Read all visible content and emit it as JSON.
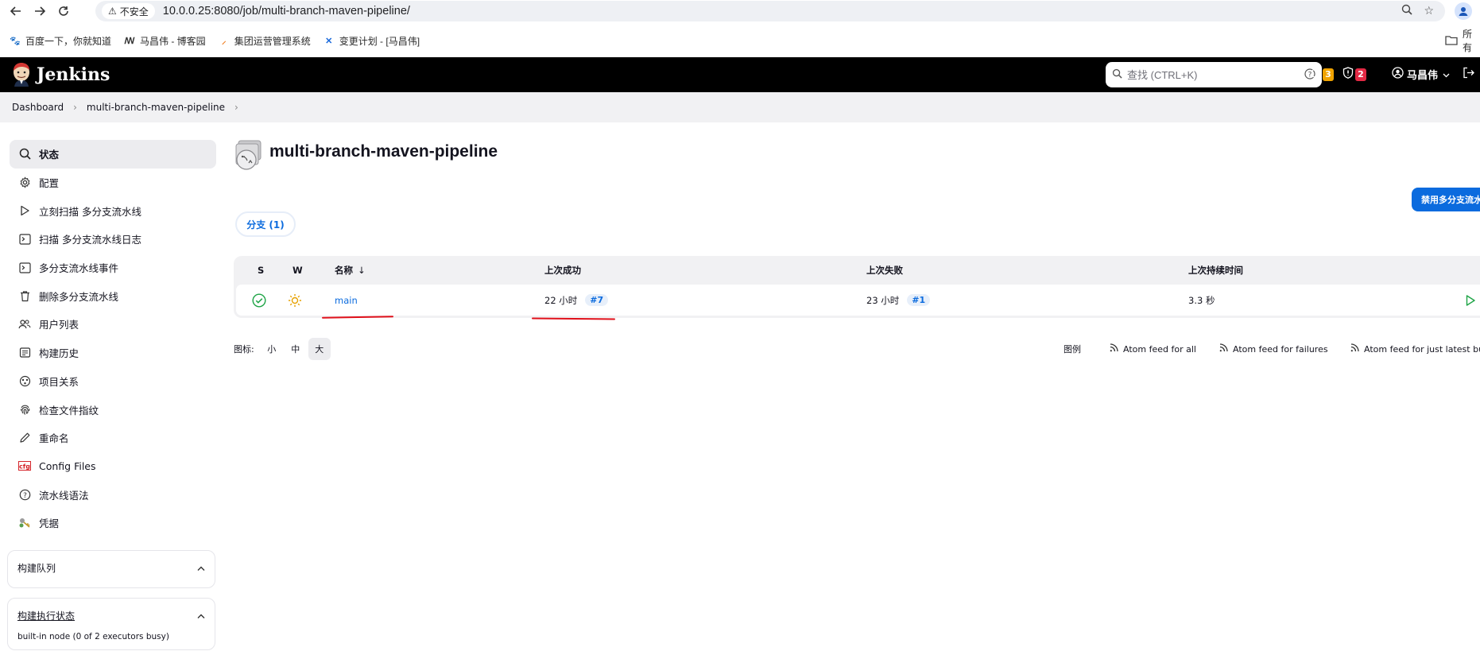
{
  "browser": {
    "insecure_label": "不安全",
    "url": "10.0.0.25:8080/job/multi-branch-maven-pipeline/",
    "bookmarks": [
      {
        "label": "百度一下，你就知道"
      },
      {
        "label": "马昌伟 - 博客园"
      },
      {
        "label": "集团运营管理系统"
      },
      {
        "label": "变更计划 - [马昌伟]"
      }
    ],
    "all_bookmarks_label": "所有"
  },
  "header": {
    "app_title": "Jenkins",
    "search_placeholder": "查找 (CTRL+K)",
    "notifications_count": "3",
    "security_count": "2",
    "user_name": "马昌伟",
    "colors": {
      "notif_badge": "#f0a300",
      "security_badge": "#e42a45"
    }
  },
  "breadcrumb": {
    "items": [
      "Dashboard",
      "multi-branch-maven-pipeline"
    ]
  },
  "sidebar": {
    "items": [
      {
        "label": "状态",
        "icon": "search-icon"
      },
      {
        "label": "配置",
        "icon": "gear-icon"
      },
      {
        "label": "立刻扫描 多分支流水线",
        "icon": "play-icon"
      },
      {
        "label": "扫描 多分支流水线日志",
        "icon": "terminal-icon"
      },
      {
        "label": "多分支流水线事件",
        "icon": "terminal-icon"
      },
      {
        "label": "删除多分支流水线",
        "icon": "trash-icon"
      },
      {
        "label": "用户列表",
        "icon": "users-icon"
      },
      {
        "label": "构建历史",
        "icon": "history-icon"
      },
      {
        "label": "项目关系",
        "icon": "relations-icon"
      },
      {
        "label": "检查文件指纹",
        "icon": "fingerprint-icon"
      },
      {
        "label": "重命名",
        "icon": "pencil-icon"
      },
      {
        "label": "Config Files",
        "icon": "cfg-icon"
      },
      {
        "label": "流水线语法",
        "icon": "help-icon"
      },
      {
        "label": "凭据",
        "icon": "credentials-icon"
      }
    ],
    "build_queue_title": "构建队列",
    "executor_status_title": "构建执行状态",
    "executor_node_text": "built-in node (0 of 2 executors busy)"
  },
  "main": {
    "job_title": "multi-branch-maven-pipeline",
    "disable_button": "禁用多分支流水",
    "branches_tab": "分支 (1)",
    "table": {
      "headers": {
        "s": "S",
        "w": "W",
        "name": "名称",
        "sort_arrow": "↓",
        "last_success": "上次成功",
        "last_failure": "上次失败",
        "last_duration": "上次持续时间"
      },
      "rows": [
        {
          "name": "main",
          "last_success_time": "22 小时",
          "last_success_build": "#7",
          "last_failure_time": "23 小时",
          "last_failure_build": "#1",
          "last_duration": "3.3 秒"
        }
      ]
    },
    "icon_size": {
      "label": "图标:",
      "small": "小",
      "medium": "中",
      "large": "大",
      "selected": "大"
    },
    "legend_label": "图例",
    "feeds": [
      "Atom feed for all",
      "Atom feed for failures",
      "Atom feed for just latest builds"
    ]
  }
}
